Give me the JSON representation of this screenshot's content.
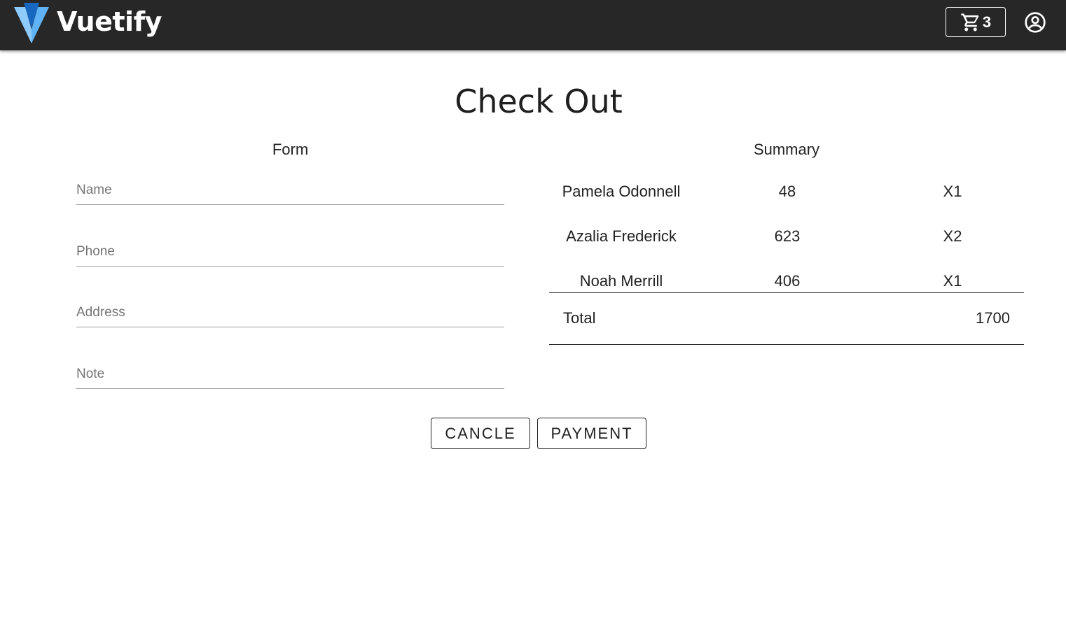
{
  "header": {
    "brand": "Vuetify",
    "cart_count": "3",
    "logo_icon": "vuetify-logo",
    "cart_icon": "cart-icon",
    "account_icon": "account-circle-icon"
  },
  "page": {
    "title": "Check Out"
  },
  "form": {
    "heading": "Form",
    "fields": [
      {
        "placeholder": "Name",
        "value": ""
      },
      {
        "placeholder": "Phone",
        "value": ""
      },
      {
        "placeholder": "Address",
        "value": ""
      },
      {
        "placeholder": "Note",
        "value": ""
      }
    ]
  },
  "summary": {
    "heading": "Summary",
    "items": [
      {
        "name": "Pamela Odonnell",
        "price": "48",
        "qty": "X1"
      },
      {
        "name": "Azalia Frederick",
        "price": "623",
        "qty": "X2"
      },
      {
        "name": "Noah Merrill",
        "price": "406",
        "qty": "X1"
      }
    ],
    "total_label": "Total",
    "total_value": "1700"
  },
  "actions": {
    "cancel_label": "CANCLE",
    "payment_label": "PAYMENT"
  },
  "colors": {
    "appbar": "#272727",
    "logo_light": "#8ecafc",
    "logo_dark": "#1867c0"
  }
}
